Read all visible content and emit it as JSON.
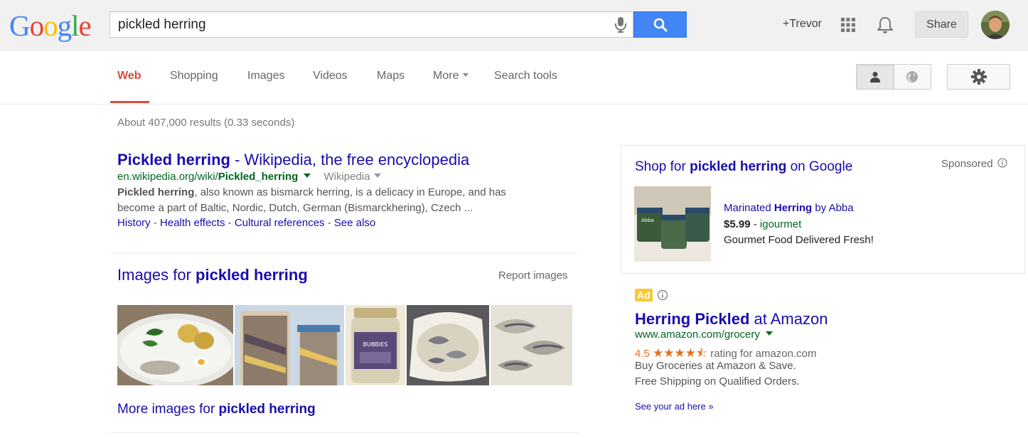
{
  "header": {
    "logo_letters": [
      {
        "char": "G",
        "color": "#4285f4"
      },
      {
        "char": "o",
        "color": "#ea4335"
      },
      {
        "char": "o",
        "color": "#fbbc05"
      },
      {
        "char": "g",
        "color": "#4285f4"
      },
      {
        "char": "l",
        "color": "#34a853"
      },
      {
        "char": "e",
        "color": "#ea4335"
      }
    ],
    "search_query": "pickled herring",
    "user_link": "+Trevor",
    "share_label": "Share",
    "icons": {
      "mic": "microphone-icon",
      "search": "magnifier-icon",
      "apps": "apps-grid-icon",
      "notifications": "bell-icon",
      "avatar": "user-avatar"
    }
  },
  "nav": {
    "tabs": [
      {
        "label": "Web",
        "active": true
      },
      {
        "label": "Shopping"
      },
      {
        "label": "Images"
      },
      {
        "label": "Videos"
      },
      {
        "label": "Maps"
      },
      {
        "label": "More"
      },
      {
        "label": "Search tools"
      }
    ],
    "accent_color": "#dd4b39"
  },
  "results": {
    "stats": "About 407,000 results (0.33 seconds)",
    "organic": [
      {
        "title_bold": "Pickled herring",
        "title_rest": " - Wikipedia, the free encyclopedia",
        "url_prefix": "en.wikipedia.org/wiki/",
        "url_bold": "Pickled_herring",
        "source": "Wikipedia",
        "snippet_bold": "Pickled herring",
        "snippet_line1": ", also known as bismarck herring, is a delicacy in Europe, and has",
        "snippet_line2": "become a part of Baltic, Nordic, Dutch, German (Bismarckhering), Czech ...",
        "sitelinks": [
          "History",
          "Health effects",
          "Cultural references",
          "See also"
        ],
        "sitelink_sep": " - "
      }
    ],
    "images_block": {
      "heading_prefix": "Images for ",
      "heading_bold": "pickled herring",
      "report_label": "Report images",
      "thumbnails": [
        "plate-with-herring-and-potatoes",
        "jars-of-herring",
        "bubbies-jar",
        "herring-in-dish",
        "herring-pieces-closeup"
      ],
      "more_prefix": "More images for ",
      "more_bold": "pickled herring"
    }
  },
  "sidebar": {
    "shopping": {
      "title_prefix": "Shop for ",
      "title_bold": "pickled herring",
      "title_suffix": " on Google",
      "sponsored_label": "Sponsored",
      "product_prefix": "Marinated ",
      "product_bold": "Herring",
      "product_suffix": " by Abba",
      "price": "$5.99",
      "price_sep": " - ",
      "seller": "igourmet",
      "description": "Gourmet Food Delivered Fresh!",
      "jar_label": "Abba"
    },
    "ad": {
      "badge": "Ad",
      "title_bold": "Herring Pickled",
      "title_rest": " at Amazon",
      "url": "www.amazon.com/grocery",
      "rating_value": "4.5",
      "rating_stars": "★★★★⯪",
      "rating_suffix": " rating for amazon.com",
      "line1": "Buy Groceries at Amazon & Save.",
      "line2": "Free Shipping on Qualified Orders.",
      "see_ad": "See your ad here »",
      "badge_color": "#f8c733"
    }
  }
}
